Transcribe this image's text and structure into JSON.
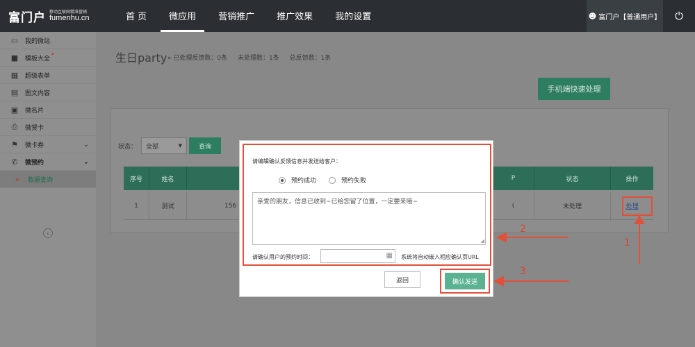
{
  "header": {
    "logo_text": "富门户",
    "logo_tagline": "移动互联网精准营销",
    "logo_domain": "fumenhu.cn",
    "nav": [
      "首 页",
      "微应用",
      "营销推广",
      "推广效果",
      "我的设置"
    ],
    "active_nav": "微应用",
    "user_label": "富门户【普通用户】",
    "icons": [
      "person-icon",
      "power-icon"
    ]
  },
  "sidebar": {
    "items": [
      {
        "label": "我的微站",
        "icon": "monitor-icon"
      },
      {
        "label": "模板大全",
        "icon": "folder-icon"
      },
      {
        "label": "超级表单",
        "icon": "calendar-icon"
      },
      {
        "label": "图文内容",
        "icon": "book-icon"
      },
      {
        "label": "微名片",
        "icon": "card-icon"
      },
      {
        "label": "微贺卡",
        "icon": "print-icon"
      },
      {
        "label": "微卡券",
        "icon": "gift-icon"
      },
      {
        "label": "微预约",
        "icon": "phone-icon"
      },
      {
        "label": "数据查询",
        "icon": "double-chevron-icon"
      }
    ],
    "active_item": "数据查询"
  },
  "main": {
    "title": "生日party",
    "stats": {
      "processed": "» 已处理反馈数：0条",
      "unprocessed": "未处理数：1条",
      "total": "总反馈数：1条"
    },
    "quick_button": "手机端快速处理",
    "filter": {
      "label": "状态：",
      "selected": "全部",
      "query_button": "查询"
    },
    "table": {
      "headers": [
        "序号",
        "姓名",
        "",
        "",
        "P",
        "状态",
        "操作"
      ],
      "rows": [
        {
          "no": "1",
          "name": "测试",
          "phone": "156",
          "extra": "(",
          "status": "未处理",
          "action": "处理"
        }
      ]
    }
  },
  "modal": {
    "prompt": "请编辑确认反馈信息并发送给客户：",
    "radio_success": "预约成功",
    "radio_fail": "预约失败",
    "message": "亲爱的朋友，信息已收到~已给您留了位置，一定要来哦~",
    "time_label": "请确认用户的预约时间：",
    "url_note": "系统将自动嵌入相应确认页URL",
    "back_button": "返回",
    "send_button": "确认发送"
  },
  "annotations": {
    "steps": [
      "1",
      "2",
      "3"
    ],
    "color": "#e0503a"
  },
  "colors": {
    "accent_green": "#2d7d61",
    "topbar": "#2b2f33",
    "send_green": "#5ab290"
  }
}
